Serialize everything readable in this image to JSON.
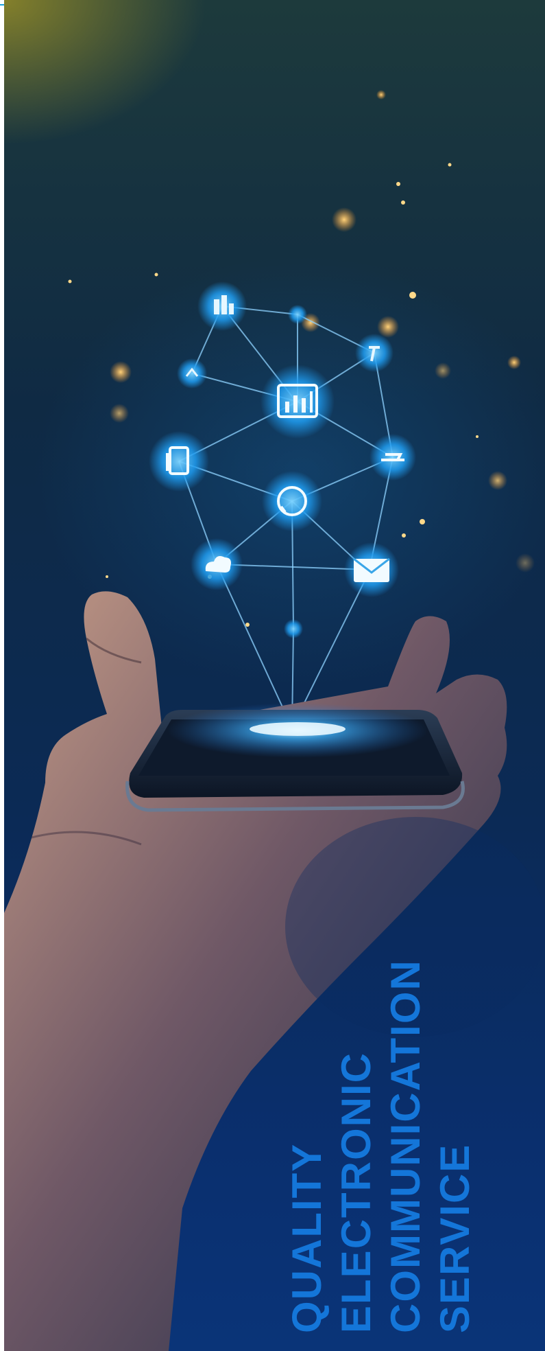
{
  "tagline": {
    "line1": "QUALITY",
    "line2": "ELECTRONIC",
    "line3": "COMMUNICATION",
    "line4": "SERVICE"
  },
  "colors": {
    "accent_rule": "#1aa3e0",
    "tagline_text": "#1476d9",
    "glow_icon": "#2aa8ff"
  },
  "hero_image": {
    "network_icons": [
      "building-icon",
      "chart-icon",
      "tablet-icon",
      "support-icon",
      "cloud-icon",
      "mail-icon",
      "hammer-icon",
      "cart-icon",
      "tag-icon"
    ]
  }
}
